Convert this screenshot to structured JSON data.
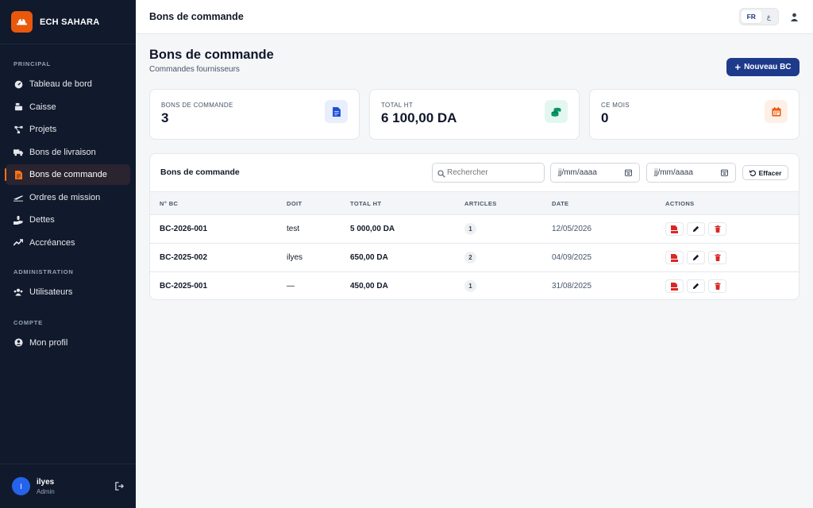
{
  "app": {
    "name": "ECH SAHARA"
  },
  "sidebar": {
    "sections": [
      {
        "title": "PRINCIPAL",
        "items": [
          {
            "label": "Tableau de bord",
            "icon": "dashboard-icon"
          },
          {
            "label": "Caisse",
            "icon": "cash-register-icon"
          },
          {
            "label": "Projets",
            "icon": "project-diagram-icon"
          },
          {
            "label": "Bons de livraison",
            "icon": "truck-icon"
          },
          {
            "label": "Bons de commande",
            "icon": "document-icon",
            "active": true
          },
          {
            "label": "Ordres de mission",
            "icon": "plane-icon"
          },
          {
            "label": "Dettes",
            "icon": "hand-holding-icon"
          },
          {
            "label": "Accréances",
            "icon": "trend-up-icon"
          }
        ]
      },
      {
        "title": "ADMINISTRATION",
        "items": [
          {
            "label": "Utilisateurs",
            "icon": "users-icon"
          }
        ]
      },
      {
        "title": "COMPTE",
        "items": [
          {
            "label": "Mon profil",
            "icon": "user-circle-icon"
          }
        ]
      }
    ],
    "user": {
      "initial": "I",
      "name": "ilyes",
      "role": "Admin"
    }
  },
  "topbar": {
    "title": "Bons de commande",
    "lang": [
      "FR",
      "ع"
    ]
  },
  "page": {
    "title": "Bons de commande",
    "subtitle": "Commandes fournisseurs",
    "new_button": "Nouveau BC"
  },
  "stats": [
    {
      "label": "BONS DE COMMANDE",
      "value": "3",
      "icon": "document-icon",
      "color": "#1d4ed8",
      "bg": "#e8eefc"
    },
    {
      "label": "TOTAL HT",
      "value": "6 100,00 DA",
      "icon": "coins-icon",
      "color": "#059669",
      "bg": "#e4f7ef"
    },
    {
      "label": "CE MOIS",
      "value": "0",
      "icon": "calendar-icon",
      "color": "#ea580c",
      "bg": "#fdf0e6"
    }
  ],
  "list": {
    "title": "Bons de commande",
    "search_placeholder": "Rechercher",
    "date_placeholder": "jj/mm/aaaa",
    "clear_label": "Effacer",
    "columns": [
      "N° BC",
      "DOIT",
      "TOTAL HT",
      "ARTICLES",
      "DATE",
      "ACTIONS"
    ],
    "rows": [
      {
        "num": "BC-2026-001",
        "doit": "test",
        "total": "5 000,00 DA",
        "articles": "1",
        "date": "12/05/2026"
      },
      {
        "num": "BC-2025-002",
        "doit": "ilyes",
        "total": "650,00 DA",
        "articles": "2",
        "date": "04/09/2025"
      },
      {
        "num": "BC-2025-001",
        "doit": "—",
        "total": "450,00 DA",
        "articles": "1",
        "date": "31/08/2025"
      }
    ]
  },
  "colors": {
    "sidebar_bg": "#111a2c",
    "accent": "#ea580c",
    "primary": "#1e3a8a",
    "danger": "#dc2626"
  }
}
